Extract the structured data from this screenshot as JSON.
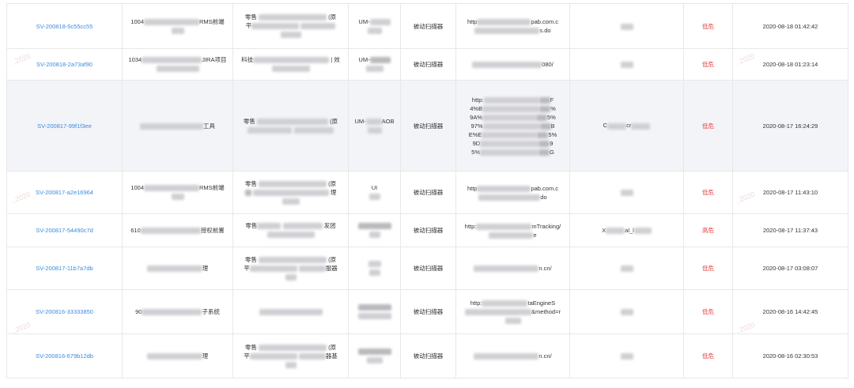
{
  "rows": [
    {
      "id": "SV-200818-5c55cc55",
      "name": "RMS前端",
      "dept": "零售",
      "tool": "被动扫描器",
      "url": [
        "http",
        "pab.com.c",
        "s.do"
      ],
      "owner": "UM-",
      "risk": "低危",
      "time": "2020-08-18 01:42:42"
    },
    {
      "id": "SV-200818-2a73af90",
      "name": "JIRA项目",
      "dept": "科技",
      "tool": "被动扫描器",
      "url": [
        "080/"
      ],
      "owner": "UM-",
      "risk": "低危",
      "time": "2020-08-18 01:23:14"
    },
    {
      "id": "SV-200817-99f1f3ee",
      "name": "工具",
      "dept": "零售",
      "tool": "被动扫描器",
      "url": [
        "http:",
        "4%B",
        "9A%",
        "97%",
        "E%E",
        "9D",
        "5%"
      ],
      "owner": "UM-",
      "risk": "低危",
      "time": "2020-08-17 16:24:29"
    },
    {
      "id": "SV-200817-a2e16964",
      "name": "RMS前端",
      "dept": "零售",
      "tool": "被动扫描器",
      "url": [
        "http",
        "pab.com.c",
        "do"
      ],
      "owner": "UI",
      "risk": "低危",
      "time": "2020-08-17 11:43:10"
    },
    {
      "id": "SV-200817-54490c7d",
      "name": "授权前置",
      "dept": "零售",
      "tool": "被动扫描器",
      "url": [
        "http:",
        "mTracking/",
        "e"
      ],
      "owner": "",
      "risk": "高危",
      "time": "2020-08-17 11:37:43"
    },
    {
      "id": "SV-200817-11b7a7db",
      "name": "理",
      "dept": "零售",
      "tool": "被动扫描器",
      "url": [
        "n.cn/"
      ],
      "owner": "",
      "risk": "低危",
      "time": "2020-08-17 03:08:07"
    },
    {
      "id": "SV-200816-33333850",
      "name": "子系统",
      "dept": "",
      "tool": "被动扫描器",
      "url": [
        "http:",
        "taEngineS",
        "&method=r"
      ],
      "owner": "",
      "risk": "低危",
      "time": "2020-08-16 14:42:45"
    },
    {
      "id": "SV-200816-679b12db",
      "name": "理",
      "dept": "零售",
      "tool": "被动扫描器",
      "url": [
        "n.cn/"
      ],
      "owner": "",
      "risk": "低危",
      "time": "2020-08-16 02:30:53"
    }
  ],
  "fragments": {
    "r0": {
      "name_prefix": "1004",
      "dept_tail": "(原",
      "dept_2": "平"
    },
    "r1": {
      "name_prefix": "1034",
      "dept_tail": "| 效"
    },
    "r2": {
      "owner_tail": "AOB",
      "assignee": "C",
      "assignee_2": "cr"
    },
    "r3": {
      "name_prefix": "1004",
      "dept_tail": "(原",
      "dept_2": "理"
    },
    "r4": {
      "name_prefix": "610",
      "dept_tail": "发团",
      "assignee": "X",
      "assignee_2": "al_l"
    },
    "r5": {
      "dept_tail": "(原",
      "dept_2": "平",
      "dept_3": "服器"
    },
    "r6": {
      "name_prefix": "90"
    },
    "r7": {
      "dept_tail": "(原",
      "dept_2": "平",
      "dept_3": "器基"
    }
  },
  "url_right": {
    "r2": [
      "F",
      "%",
      "5%",
      "B",
      "5%",
      "9",
      "G"
    ]
  },
  "watermarks": [
    "..2020",
    "..2020",
    "..2020",
    "..2020",
    "..2020",
    "..2020"
  ]
}
